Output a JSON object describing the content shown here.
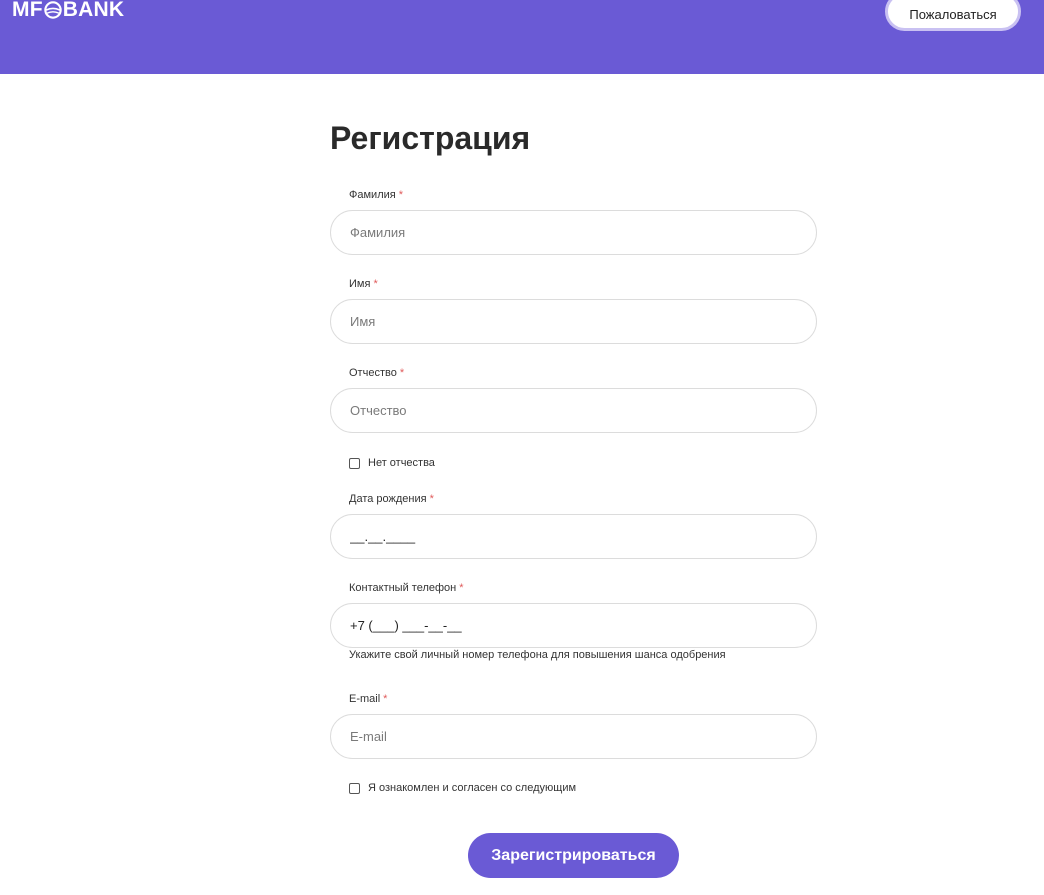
{
  "header": {
    "logo_left": "MF",
    "logo_right": "BANK",
    "complain_label": "Пожаловаться",
    "brand_color": "#6a5ad5"
  },
  "form": {
    "title": "Регистрация",
    "required_mark": "*",
    "last_name": {
      "label": "Фамилия",
      "placeholder": "Фамилия",
      "value": ""
    },
    "first_name": {
      "label": "Имя",
      "placeholder": "Имя",
      "value": ""
    },
    "patronymic": {
      "label": "Отчество",
      "placeholder": "Отчество",
      "value": ""
    },
    "no_patronymic": {
      "label": "Нет отчества",
      "checked": false
    },
    "birth_date": {
      "label": "Дата рождения",
      "value": "__.__.____"
    },
    "phone": {
      "label": "Контактный телефон",
      "value": "+7 (___) ___-__-__",
      "hint": "Укажите свой личный номер телефона для повышения шанса одобрения"
    },
    "email": {
      "label": "E-mail",
      "placeholder": "E-mail",
      "value": ""
    },
    "agreement": {
      "label": "Я ознакомлен и согласен со следующим",
      "checked": false
    },
    "submit_label": "Зарегистрироваться"
  }
}
